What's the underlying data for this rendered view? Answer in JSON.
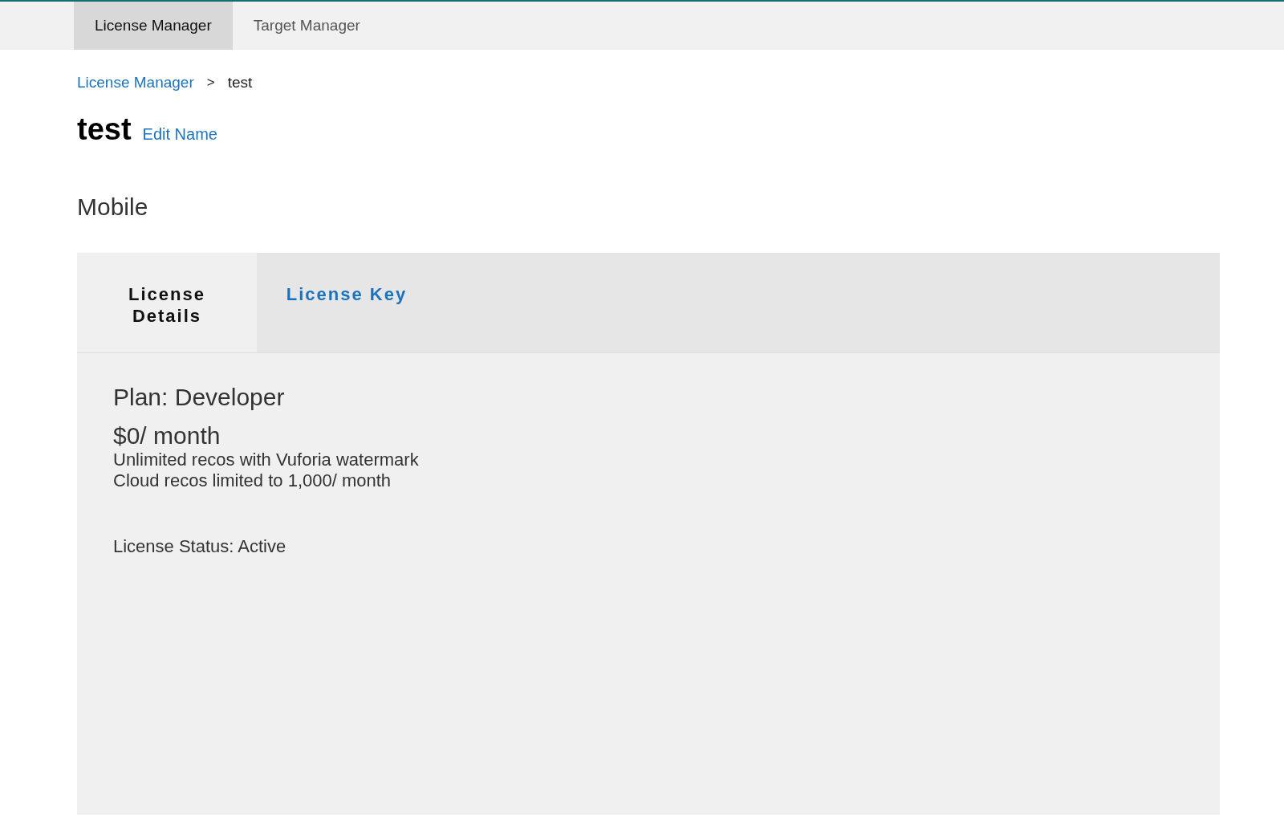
{
  "top_tabs": [
    {
      "label": "License Manager",
      "selected": true
    },
    {
      "label": "Target Manager",
      "selected": false
    }
  ],
  "breadcrumb": {
    "link": "License Manager",
    "separator": ">",
    "current": "test"
  },
  "title": "test",
  "edit_link": "Edit Name",
  "section": "Mobile",
  "panel_tabs": [
    {
      "label": "License Details",
      "selected": true
    },
    {
      "label": "License Key",
      "selected": false
    }
  ],
  "details": {
    "plan": "Plan: Developer",
    "price": "$0/ month",
    "features": [
      "Unlimited recos with Vuforia watermark",
      "Cloud recos limited to 1,000/ month"
    ],
    "status": "License Status: Active"
  }
}
